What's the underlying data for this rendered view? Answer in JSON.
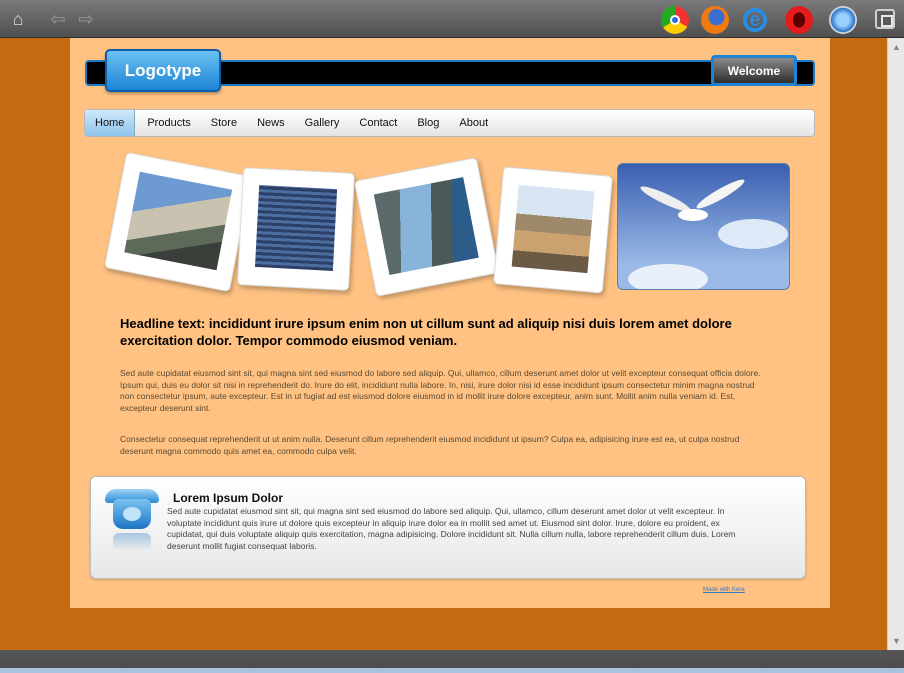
{
  "browser": {
    "icons": [
      "home-icon",
      "back-arrow-icon",
      "forward-arrow-icon",
      "chrome-icon",
      "firefox-icon",
      "internet-explorer-icon",
      "opera-icon",
      "safari-icon",
      "fullscreen-icon"
    ]
  },
  "site": {
    "logo": "Logotype",
    "welcome": "Welcome",
    "menu": [
      {
        "label": "Home",
        "active": true
      },
      {
        "label": "Products",
        "active": false
      },
      {
        "label": "Store",
        "active": false
      },
      {
        "label": "News",
        "active": false
      },
      {
        "label": "Gallery",
        "active": false
      },
      {
        "label": "Contact",
        "active": false
      },
      {
        "label": "Blog",
        "active": false
      },
      {
        "label": "About",
        "active": false
      }
    ],
    "headline": "Headline text: incididunt irure ipsum enim non ut cillum sunt ad aliquip nisi duis lorem amet dolore exercitation dolor. Tempor commodo eiusmod veniam.",
    "paragraph1": "Sed aute cupidatat eiusmod sint sit, qui magna sint sed eiusmod do labore sed aliquip. Qui, ullamco, cillum deserunt amet dolor ut velit excepteur consequat officia dolore. Ipsum qui, duis eu dolor sit nisi in reprehenderit do. Irure do elit, incididunt nulla labore. In, nisi, irure dolor nisi id esse incididunt ipsum consectetur minim magna nostrud non consectetur ipsum, aute excepteur. Est in ut fugiat ad est eiusmod dolore eiusmod in id mollit irure dolore excepteur, anim sunt. Mollit anim nulla veniam id. Est, excepteur deserunt sint.",
    "paragraph2": "Consectetur consequat reprehenderit ut ut anim nulla. Deserunt cillum reprehenderit eiusmod incididunt ut ipsum? Culpa ea, adipisicing irure est ea, ut culpa nostrud deserunt magna commodo quis amet ea, commodo culpa velit.",
    "contact": {
      "title": "Lorem Ipsum Dolor",
      "text": "Sed aute cupidatat eiusmod sint sit, qui magna sint sed eiusmod do labore sed aliquip. Qui, ullamco, cillum deserunt amet dolor ut velit excepteur. In voluptate incididunt quis irure ut dolore quis excepteur in aliquip irure dolor ea in mollit sed amet ut. Eiusmod sint dolor. Irure, dolore eu proident, ex cupidatat, qui duis voluptate aliquip quis exercitation, magna adipisicing. Dolore incididunt sit. Nulla cillum nulla, labore reprehenderit cillum duis. Lorem deserunt mollit fugiat consequat laboris.",
      "icon": "telephone-icon"
    },
    "footer_link": "Made with Kera"
  },
  "colors": {
    "background": "#c46a10",
    "page": "#ffc283",
    "accent": "#1d84d6"
  }
}
